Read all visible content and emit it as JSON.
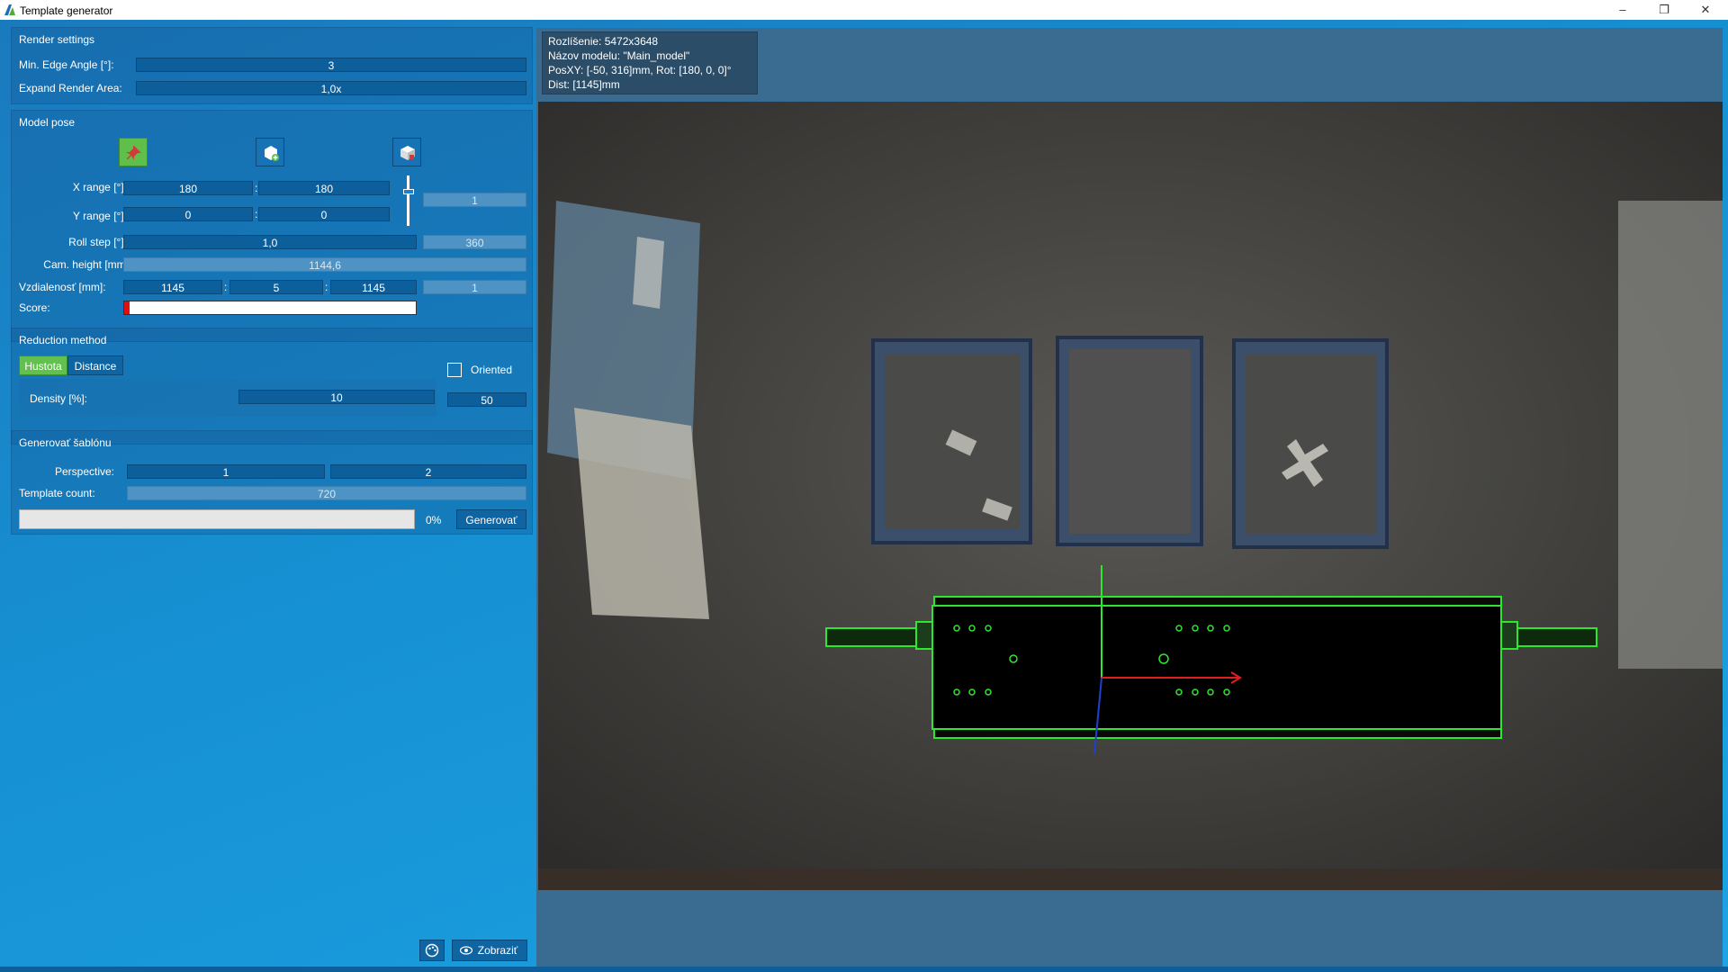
{
  "window": {
    "title": "Template generator"
  },
  "render_settings": {
    "heading": "Render settings",
    "min_edge_angle_label": "Min. Edge Angle [°]:",
    "min_edge_angle_value": "3",
    "expand_area_label": "Expand Render Area:",
    "expand_area_value": "1,0x"
  },
  "model_pose": {
    "heading": "Model pose",
    "x_range_label": "X range [°]:",
    "x_min": "180",
    "x_max": "180",
    "y_range_label": "Y range [°]:",
    "y_min": "0",
    "y_max": "0",
    "range_sep": ":",
    "range_count": "1",
    "roll_step_label": "Roll step [°]:",
    "roll_step_value": "1,0",
    "roll_count": "360",
    "cam_height_label": "Cam. height [mm]",
    "cam_height_value": "1144,6",
    "distance_label": "Vzdialenosť [mm]:",
    "dist_min": "1145",
    "dist_step": "5",
    "dist_max": "1145",
    "dist_count": "1",
    "score_label": "Score:",
    "score_fraction": 0.02,
    "slider_fraction": 0.3
  },
  "reduction": {
    "heading": "Reduction method",
    "tab_hustota": "Hustota",
    "tab_distance": "Distance",
    "oriented_label": "Oriented",
    "density_label": "Density [%]:",
    "density_value": "10",
    "density_side_value": "50"
  },
  "generate": {
    "heading": "Generovať šablónu",
    "perspective_label": "Perspective:",
    "perspective_1": "1",
    "perspective_2": "2",
    "template_count_label": "Template count:",
    "template_count_value": "720",
    "progress_text": "0%",
    "progress_fraction": 0,
    "generate_button": "Generovať"
  },
  "bottom_bar": {
    "show_button": "Zobraziť"
  },
  "overlay": {
    "resolution": "Rozlíšenie: 5472x3648",
    "model_name": "Názov modelu: \"Main_model\"",
    "pose": "PosXY: [-50, 316]mm, Rot: [180, 0, 0]°",
    "dist": "Dist: [1145]mm"
  },
  "colors": {
    "accent_green": "#5fbf4a",
    "field_blue": "#0d5f9b",
    "model_outline": "#2ee62e"
  },
  "icons": [
    "pin-icon",
    "add-view-icon",
    "cube-view-icon",
    "palette-icon",
    "eye-icon"
  ]
}
